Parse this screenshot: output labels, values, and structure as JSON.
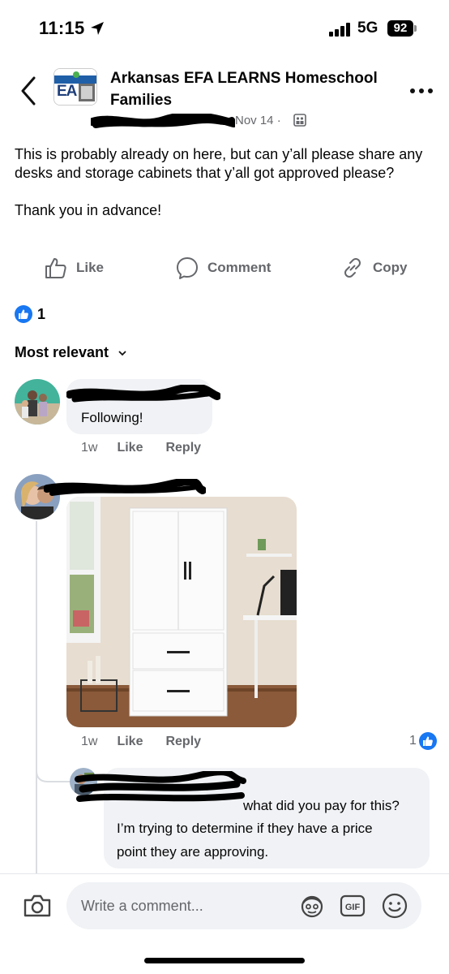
{
  "status_bar": {
    "time": "11:15",
    "network": "5G",
    "battery": "92"
  },
  "post": {
    "group_name": "Arkansas EFA LEARNS Homeschool Families",
    "group_avatar_text": "EA",
    "date": "Nov 14 ·",
    "paragraphs": [
      "This is probably already on here, but can y’all please share any desks and storage cabinets that y’all got approved please?",
      "Thank you in advance!"
    ],
    "actions": {
      "like": "Like",
      "comment": "Comment",
      "copy": "Copy"
    },
    "reaction_count": "1",
    "sort_label": "Most relevant"
  },
  "comments": [
    {
      "text": "Following!",
      "ago": "1w",
      "like": "Like",
      "reply": "Reply"
    },
    {
      "ago": "1w",
      "like": "Like",
      "reply": "Reply",
      "reaction_count": "1"
    },
    {
      "text_line1": "what did you pay for this?",
      "text_line2": "I’m trying to determine if they have a price",
      "text_line3": "point they are approving."
    }
  ],
  "composer": {
    "placeholder": "Write a comment..."
  },
  "colors": {
    "accent": "#1877f2",
    "muted": "#65676b",
    "bubble": "#f0f2f5"
  }
}
